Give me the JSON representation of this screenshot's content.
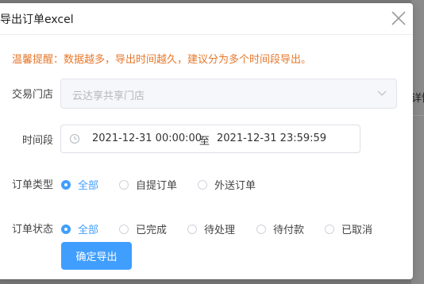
{
  "background": {
    "right_text": "详情"
  },
  "dialog": {
    "title": "导出订单excel",
    "tip": "温馨提醒：数据越多，导出时间越久，建议分为多个时间段导出。",
    "store": {
      "label": "交易门店",
      "value": "云达享共享门店"
    },
    "period": {
      "label": "时间段",
      "start": "2021-12-31 00:00:00",
      "separator": "至",
      "end": "2021-12-31 23:59:59"
    },
    "order_type": {
      "label": "订单类型",
      "options": [
        "全部",
        "自提订单",
        "外送订单"
      ],
      "selected": "全部"
    },
    "order_status": {
      "label": "订单状态",
      "options": [
        "全部",
        "已完成",
        "待处理",
        "待付款",
        "已取消"
      ],
      "selected": "全部"
    },
    "confirm_label": "确定导出"
  },
  "colors": {
    "primary": "#409eff",
    "tip": "#e6782c"
  },
  "icons": [
    "close-icon",
    "clock-icon",
    "chevron-down-icon"
  ]
}
